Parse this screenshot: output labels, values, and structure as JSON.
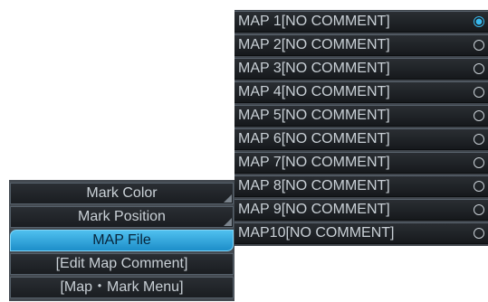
{
  "menu": {
    "items": [
      {
        "label": "Mark Color",
        "selected": false,
        "has_submenu": true
      },
      {
        "label": "Mark Position",
        "selected": false,
        "has_submenu": true
      },
      {
        "label": "MAP File",
        "selected": true,
        "has_submenu": false
      },
      {
        "label": "[Edit Map Comment]",
        "selected": false,
        "has_submenu": false
      },
      {
        "label": "[Map・Mark Menu]",
        "selected": false,
        "has_submenu": false
      }
    ]
  },
  "map_list": {
    "items": [
      {
        "label": "MAP 1[NO COMMENT]",
        "selected": true
      },
      {
        "label": "MAP 2[NO COMMENT]",
        "selected": false
      },
      {
        "label": "MAP 3[NO COMMENT]",
        "selected": false
      },
      {
        "label": "MAP 4[NO COMMENT]",
        "selected": false
      },
      {
        "label": "MAP 5[NO COMMENT]",
        "selected": false
      },
      {
        "label": "MAP 6[NO COMMENT]",
        "selected": false
      },
      {
        "label": "MAP 7[NO COMMENT]",
        "selected": false
      },
      {
        "label": "MAP 8[NO COMMENT]",
        "selected": false
      },
      {
        "label": "MAP 9[NO COMMENT]",
        "selected": false
      },
      {
        "label": "MAP10[NO COMMENT]",
        "selected": false
      }
    ]
  },
  "colors": {
    "accent": "#38b9ee",
    "panel": "#22262a",
    "text": "#c9d0d6"
  }
}
